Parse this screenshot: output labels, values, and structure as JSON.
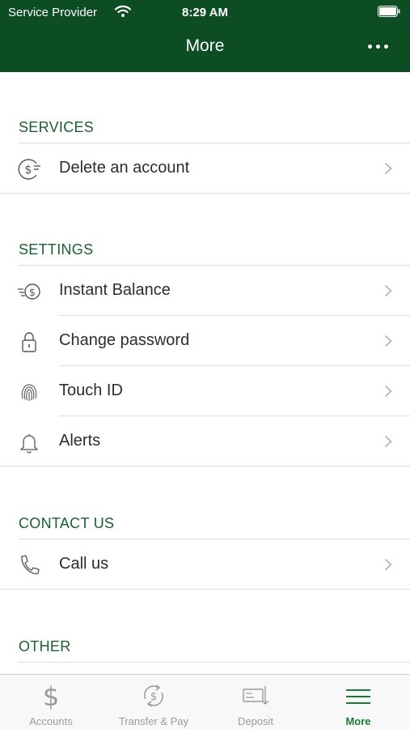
{
  "status_bar": {
    "carrier": "Service Provider",
    "time": "8:29 AM"
  },
  "nav": {
    "title": "More",
    "more_icon": "ellipsis-icon"
  },
  "colors": {
    "header": "#0d4d24",
    "section_text": "#1b5e32",
    "active_tab": "#1b7a36",
    "inactive_tab": "#9a9a9a"
  },
  "sections": {
    "services": {
      "title": "SERVICES",
      "items": [
        {
          "label": "Delete an account",
          "icon": "dollar-circle-icon"
        }
      ]
    },
    "settings": {
      "title": "SETTINGS",
      "items": [
        {
          "label": "Instant Balance",
          "icon": "fast-dollar-icon"
        },
        {
          "label": "Change password",
          "icon": "lock-icon"
        },
        {
          "label": "Touch ID",
          "icon": "fingerprint-icon"
        },
        {
          "label": "Alerts",
          "icon": "bell-icon"
        }
      ]
    },
    "contact": {
      "title": "CONTACT US",
      "items": [
        {
          "label": "Call us",
          "icon": "phone-icon"
        }
      ]
    },
    "other": {
      "title": "OTHER"
    }
  },
  "tabbar": {
    "tabs": [
      {
        "label": "Accounts",
        "icon": "dollar-icon"
      },
      {
        "label": "Transfer & Pay",
        "icon": "transfer-icon"
      },
      {
        "label": "Deposit",
        "icon": "check-deposit-icon"
      },
      {
        "label": "More",
        "icon": "menu-icon"
      }
    ],
    "active": "More"
  }
}
